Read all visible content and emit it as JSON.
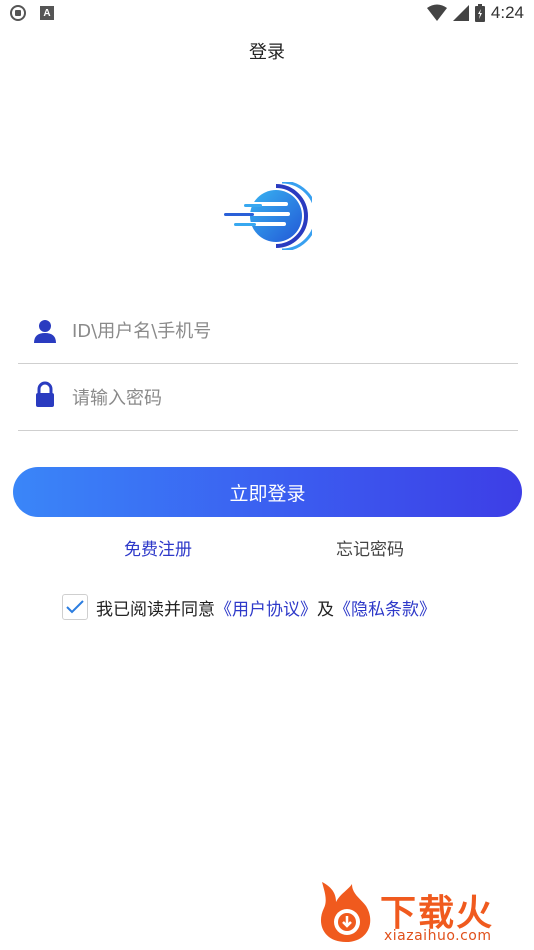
{
  "status_bar": {
    "time": "4:24",
    "left_icons": [
      "shield-icon",
      "a-icon"
    ],
    "right_icons": [
      "wifi-icon",
      "signal-icon",
      "battery-icon"
    ]
  },
  "page": {
    "title": "登录"
  },
  "form": {
    "username_placeholder": "ID\\用户名\\手机号",
    "username_value": "",
    "password_placeholder": "请输入密码",
    "password_value": "",
    "login_label": "立即登录"
  },
  "links": {
    "register": "免费注册",
    "forgot_password": "忘记密码"
  },
  "agreement": {
    "checked": true,
    "prefix": "我已阅读并同意",
    "user_agreement": "《用户协议》",
    "connector": "及",
    "privacy_policy": "《隐私条款》"
  },
  "watermark": {
    "brand": "下载火",
    "url": "xiazaihuo.com"
  },
  "colors": {
    "accent": "#2e39c9",
    "button_gradient_start": "#3a86f8",
    "button_gradient_end": "#3d3ee6",
    "icon_blue": "#2a3bc0",
    "watermark_orange": "#f05a1e"
  }
}
